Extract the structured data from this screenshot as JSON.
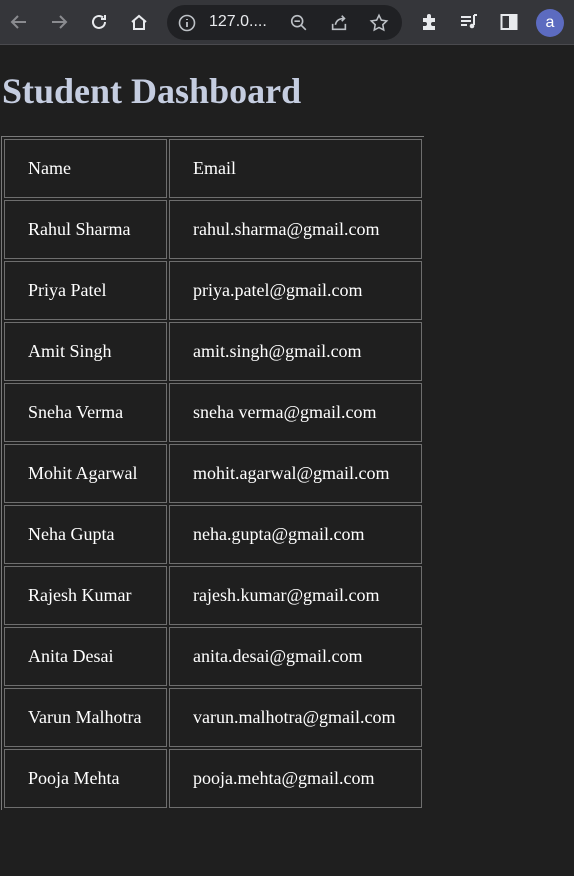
{
  "browser": {
    "url": "127.0....",
    "avatar_letter": "a"
  },
  "page": {
    "title": "Student Dashboard"
  },
  "table": {
    "headers": [
      "Name",
      "Email"
    ],
    "rows": [
      {
        "name": "Rahul Sharma",
        "email": "rahul.sharma@gmail.com"
      },
      {
        "name": "Priya Patel",
        "email": "priya.patel@gmail.com"
      },
      {
        "name": "Amit Singh",
        "email": "amit.singh@gmail.com"
      },
      {
        "name": "Sneha Verma",
        "email": "sneha verma@gmail.com"
      },
      {
        "name": "Mohit Agarwal",
        "email": "mohit.agarwal@gmail.com"
      },
      {
        "name": "Neha Gupta",
        "email": "neha.gupta@gmail.com"
      },
      {
        "name": "Rajesh Kumar",
        "email": "rajesh.kumar@gmail.com"
      },
      {
        "name": "Anita Desai",
        "email": "anita.desai@gmail.com"
      },
      {
        "name": "Varun Malhotra",
        "email": "varun.malhotra@gmail.com"
      },
      {
        "name": "Pooja Mehta",
        "email": "pooja.mehta@gmail.com"
      }
    ]
  }
}
